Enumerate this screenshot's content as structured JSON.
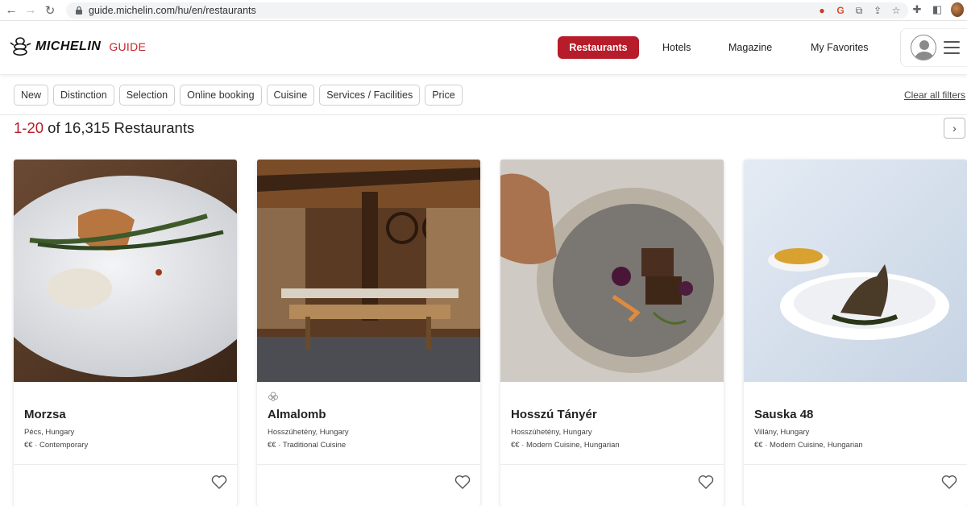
{
  "browser": {
    "url": "guide.michelin.com/hu/en/restaurants"
  },
  "header": {
    "logo_word": "MICHELIN",
    "logo_guide": "GUIDE",
    "nav": {
      "restaurants": "Restaurants",
      "hotels": "Hotels",
      "magazine": "Magazine",
      "favorites": "My Favorites"
    }
  },
  "filters": {
    "chips": [
      "New",
      "Distinction",
      "Selection",
      "Online booking",
      "Cuisine",
      "Services / Facilities",
      "Price"
    ],
    "clear": "Clear all filters"
  },
  "results": {
    "range": "1-20",
    "rest": " of 16,315 Restaurants"
  },
  "restaurants": [
    {
      "name": "Morzsa",
      "location": "Pécs, Hungary",
      "cuisine": "€€ · Contemporary",
      "award": false
    },
    {
      "name": "Almalomb",
      "location": "Hosszúhetény, Hungary",
      "cuisine": "€€ · Traditional Cuisine",
      "award": true
    },
    {
      "name": "Hosszú Tányér",
      "location": "Hosszúhetény, Hungary",
      "cuisine": "€€ · Modern Cuisine, Hungarian",
      "award": false
    },
    {
      "name": "Sauska 48",
      "location": "Villány, Hungary",
      "cuisine": "€€ · Modern Cuisine, Hungarian",
      "award": false
    }
  ],
  "colors": {
    "brand_red": "#b71c2a"
  }
}
